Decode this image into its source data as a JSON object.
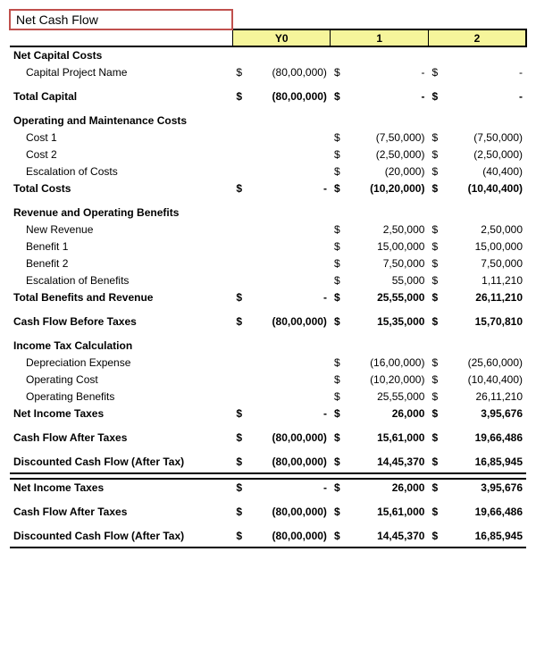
{
  "title": "Net Cash Flow",
  "headers": {
    "y0": "Y0",
    "y1": "1",
    "y2": "2"
  },
  "ncc": {
    "label": "Net Capital Costs",
    "proj_label": "Capital Project Name",
    "proj": {
      "y0": "(80,00,000)",
      "y1": "-",
      "y2": "-"
    },
    "total_label": "Total Capital",
    "total": {
      "y0": "(80,00,000)",
      "y1": "-",
      "y2": "-"
    }
  },
  "omc": {
    "label": "Operating and Maintenance Costs",
    "cost1_label": "Cost 1",
    "cost1": {
      "y1": "(7,50,000)",
      "y2": "(7,50,000)"
    },
    "cost2_label": "Cost 2",
    "cost2": {
      "y1": "(2,50,000)",
      "y2": "(2,50,000)"
    },
    "esc_label": "Escalation of Costs",
    "esc": {
      "y1": "(20,000)",
      "y2": "(40,400)"
    },
    "total_label": "Total Costs",
    "total": {
      "y0": "-",
      "y1": "(10,20,000)",
      "y2": "(10,40,400)"
    }
  },
  "rev": {
    "label": "Revenue and Operating Benefits",
    "newrev_label": "New Revenue",
    "newrev": {
      "y1": "2,50,000",
      "y2": "2,50,000"
    },
    "b1_label": "Benefit 1",
    "b1": {
      "y1": "15,00,000",
      "y2": "15,00,000"
    },
    "b2_label": "Benefit 2",
    "b2": {
      "y1": "7,50,000",
      "y2": "7,50,000"
    },
    "esc_label": "Escalation of Benefits",
    "esc": {
      "y1": "55,000",
      "y2": "1,11,210"
    },
    "total_label": "Total Benefits and Revenue",
    "total": {
      "y0": "-",
      "y1": "25,55,000",
      "y2": "26,11,210"
    }
  },
  "cfbt": {
    "label": "Cash Flow Before Taxes",
    "v": {
      "y0": "(80,00,000)",
      "y1": "15,35,000",
      "y2": "15,70,810"
    }
  },
  "tax": {
    "label": "Income Tax Calculation",
    "dep_label": "Depreciation Expense",
    "dep": {
      "y1": "(16,00,000)",
      "y2": "(25,60,000)"
    },
    "opc_label": "Operating Cost",
    "opc": {
      "y1": "(10,20,000)",
      "y2": "(10,40,400)"
    },
    "opb_label": "Operating Benefits",
    "opb": {
      "y1": "25,55,000",
      "y2": "26,11,210"
    },
    "net_label": "Net Income Taxes",
    "net": {
      "y0": "-",
      "y1": "26,000",
      "y2": "3,95,676"
    }
  },
  "cfat": {
    "label": "Cash Flow After Taxes",
    "v": {
      "y0": "(80,00,000)",
      "y1": "15,61,000",
      "y2": "19,66,486"
    }
  },
  "dcf": {
    "label": "Discounted Cash Flow (After Tax)",
    "v": {
      "y0": "(80,00,000)",
      "y1": "14,45,370",
      "y2": "16,85,945"
    }
  },
  "rep": {
    "nit_label": "Net Income Taxes",
    "nit": {
      "y0": "-",
      "y1": "26,000",
      "y2": "3,95,676"
    },
    "cfat_label": "Cash Flow After Taxes",
    "cfat": {
      "y0": "(80,00,000)",
      "y1": "15,61,000",
      "y2": "19,66,486"
    },
    "dcf_label": "Discounted Cash Flow (After Tax)",
    "dcf": {
      "y0": "(80,00,000)",
      "y1": "14,45,370",
      "y2": "16,85,945"
    }
  },
  "sym": "$"
}
